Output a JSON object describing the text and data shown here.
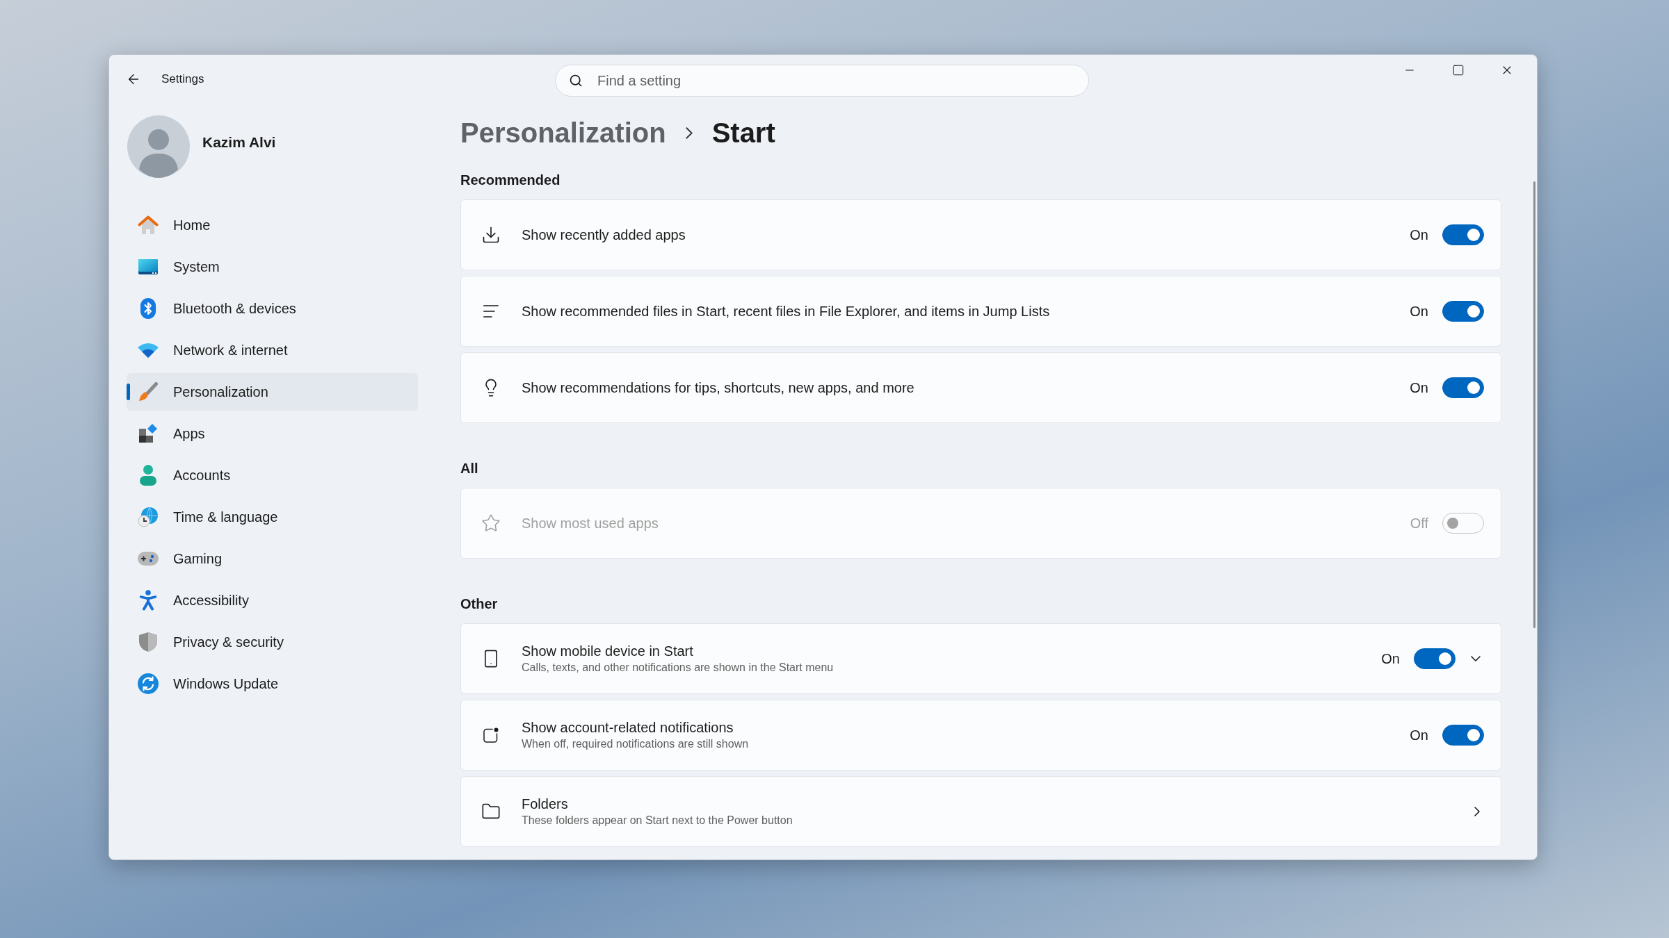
{
  "window": {
    "title": "Settings",
    "search": {
      "placeholder": "Find a setting"
    }
  },
  "user": {
    "name": "Kazim Alvi"
  },
  "sidebar": {
    "items": [
      {
        "label": "Home",
        "selected": false
      },
      {
        "label": "System",
        "selected": false
      },
      {
        "label": "Bluetooth & devices",
        "selected": false
      },
      {
        "label": "Network & internet",
        "selected": false
      },
      {
        "label": "Personalization",
        "selected": true
      },
      {
        "label": "Apps",
        "selected": false
      },
      {
        "label": "Accounts",
        "selected": false
      },
      {
        "label": "Time & language",
        "selected": false
      },
      {
        "label": "Gaming",
        "selected": false
      },
      {
        "label": "Accessibility",
        "selected": false
      },
      {
        "label": "Privacy & security",
        "selected": false
      },
      {
        "label": "Windows Update",
        "selected": false
      }
    ]
  },
  "breadcrumb": [
    {
      "label": "Personalization",
      "current": false
    },
    {
      "label": "Start",
      "current": true
    }
  ],
  "sections": [
    {
      "heading": "Recommended",
      "rows": [
        {
          "kind": "toggle",
          "title": "Show recently added apps",
          "state_label": "On",
          "on": true,
          "disabled": false
        },
        {
          "kind": "toggle",
          "title": "Show recommended files in Start, recent files in File Explorer, and items in Jump Lists",
          "state_label": "On",
          "on": true,
          "disabled": false
        },
        {
          "kind": "toggle",
          "title": "Show recommendations for tips, shortcuts, new apps, and more",
          "state_label": "On",
          "on": true,
          "disabled": false
        }
      ]
    },
    {
      "heading": "All",
      "rows": [
        {
          "kind": "toggle",
          "title": "Show most used apps",
          "state_label": "Off",
          "on": false,
          "disabled": true
        }
      ]
    },
    {
      "heading": "Other",
      "rows": [
        {
          "kind": "expander",
          "title": "Show mobile device in Start",
          "description": "Calls, texts, and other notifications are shown in the Start menu",
          "state_label": "On",
          "on": true,
          "disabled": false,
          "expanded": false
        },
        {
          "kind": "toggle",
          "title": "Show account-related notifications",
          "description": "When off, required notifications are still shown",
          "state_label": "On",
          "on": true,
          "disabled": false
        },
        {
          "kind": "link",
          "title": "Folders",
          "description": "These folders appear on Start next to the Power button"
        }
      ]
    }
  ]
}
